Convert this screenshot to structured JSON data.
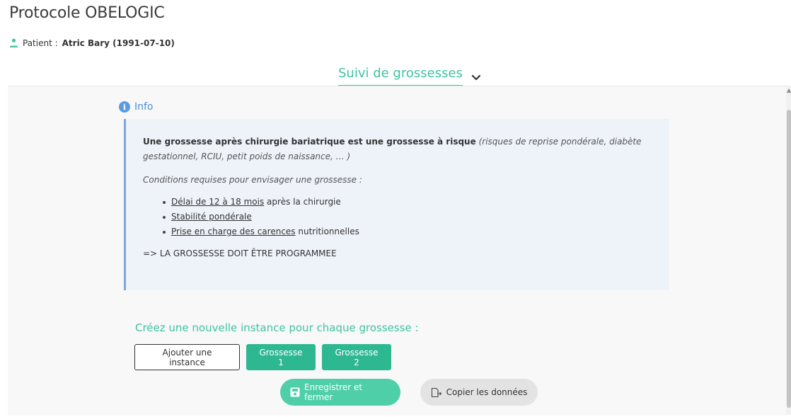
{
  "page": {
    "title": "Protocole OBELOGIC",
    "patient_label": "Patient :",
    "patient_name": "Atric Bary (1991-07-10)"
  },
  "section": {
    "title": "Suivi de grossesses"
  },
  "info": {
    "heading": "Info",
    "p1_bold": "Une grossesse après chirurgie bariatrique est une grossesse à risque",
    "p1_italic": "(risques de reprise pondérale, diabète gestationnel, RCIU, petit poids de naissance, … )",
    "p2": "Conditions requises pour envisager une grossesse :",
    "list": [
      {
        "underlined": "Délai de 12 à 18 mois",
        "rest": " après la chirurgie"
      },
      {
        "underlined": "Stabilité pondérale",
        "rest": ""
      },
      {
        "underlined": "Prise en charge des carences",
        "rest": " nutritionnelles"
      }
    ],
    "conclusion": "=> LA GROSSESSE DOIT ÊTRE PROGRAMMEE"
  },
  "instances": {
    "heading": "Créez une nouvelle instance pour chaque grossesse :",
    "add_label": "Ajouter une instance",
    "items": [
      "Grossesse 1",
      "Grossesse 2"
    ]
  },
  "actions": {
    "save_label": "Enregistrer et fermer",
    "copy_label": "Copier les données"
  },
  "colors": {
    "accent_green": "#3fc3a2",
    "button_green": "#2eb892",
    "info_blue": "#4a90d9",
    "info_bg": "#eef3f9"
  }
}
